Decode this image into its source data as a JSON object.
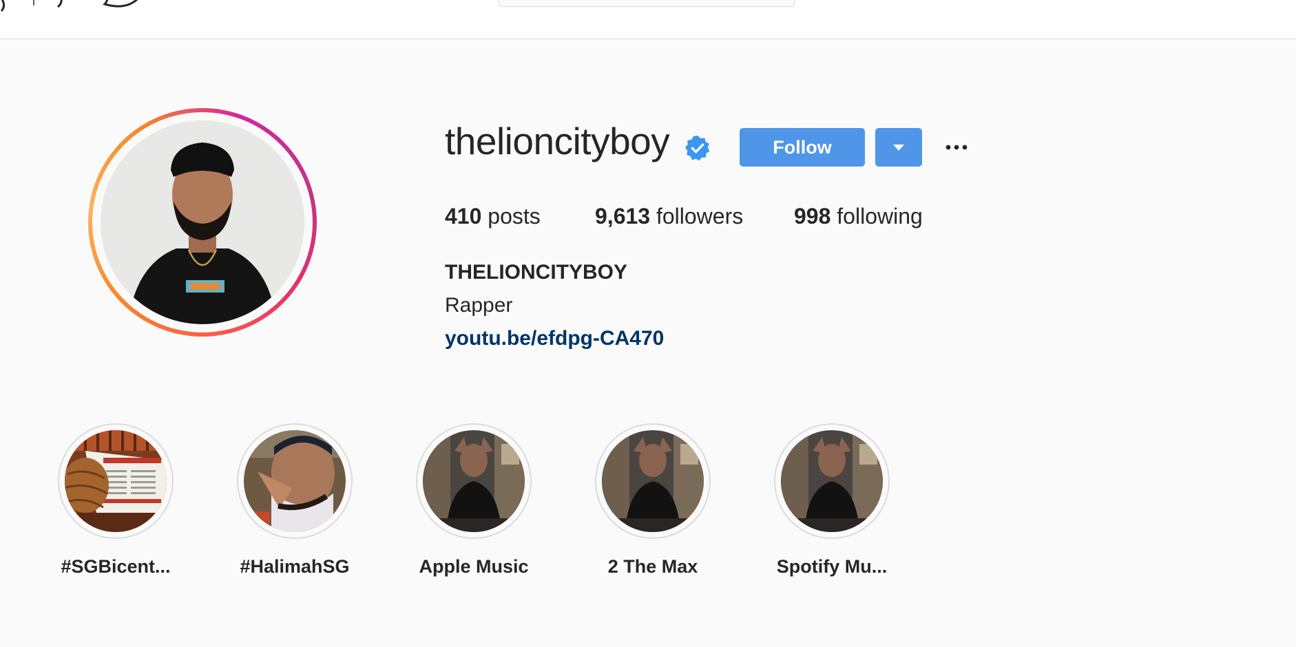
{
  "profile": {
    "username": "thelioncityboy",
    "verified_icon": "verified-badge-icon",
    "follow_label": "Follow",
    "dropdown_icon": "caret-down-icon",
    "more_icon": "ellipsis-icon",
    "stats": {
      "posts_count": "410",
      "posts_label": "posts",
      "followers_count": "9,613",
      "followers_label": "followers",
      "following_count": "998",
      "following_label": "following"
    },
    "full_name": "THELIONCITYBOY",
    "bio": "Rapper",
    "link": "youtu.be/efdpg-CA470"
  },
  "highlights": [
    {
      "label": "#SGBicent..."
    },
    {
      "label": "#HalimahSG"
    },
    {
      "label": "Apple Music"
    },
    {
      "label": "2 The Max"
    },
    {
      "label": "Spotify Mu..."
    }
  ],
  "colors": {
    "accent": "#4f96e8",
    "link": "#003569",
    "background": "#fafafa",
    "text": "#262626",
    "verified": "#3897f0"
  }
}
